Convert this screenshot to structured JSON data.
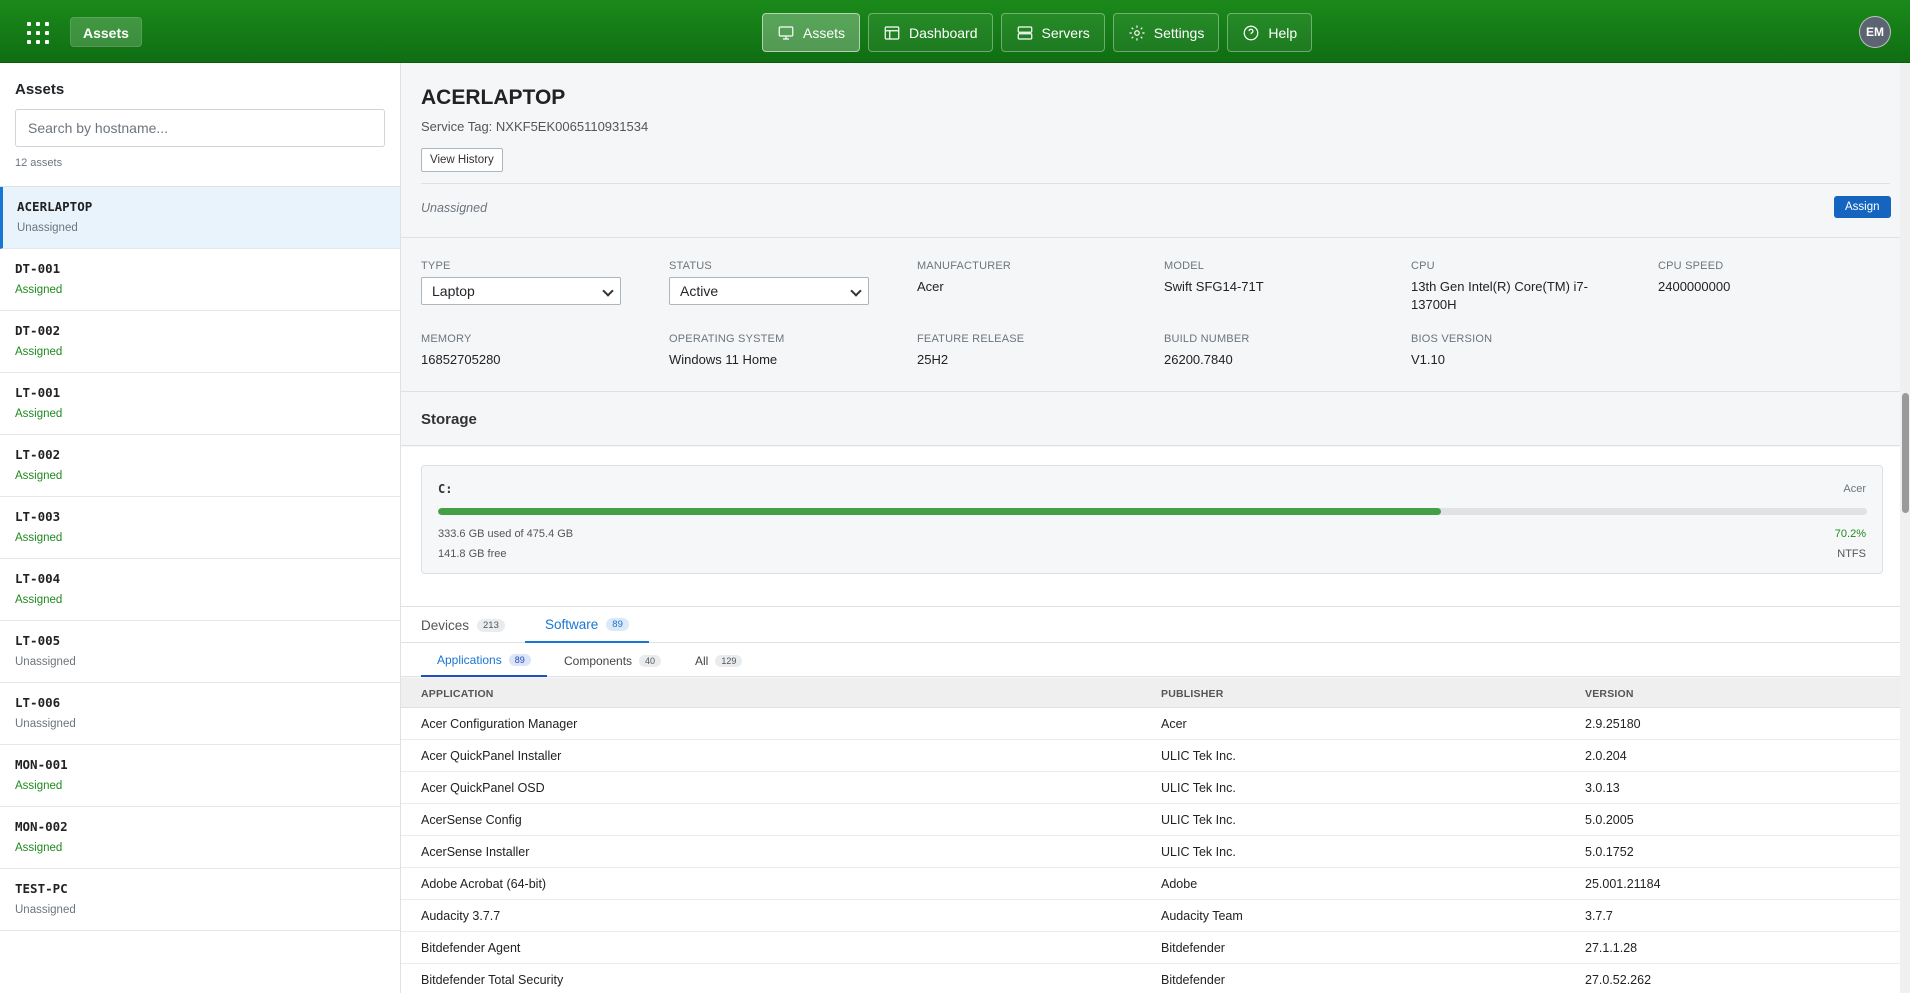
{
  "topbar": {
    "brand": "Assets",
    "nav": [
      {
        "label": "Assets",
        "icon": "monitor-icon",
        "active": true
      },
      {
        "label": "Dashboard",
        "icon": "dashboard-icon",
        "active": false
      },
      {
        "label": "Servers",
        "icon": "server-icon",
        "active": false
      },
      {
        "label": "Settings",
        "icon": "gear-icon",
        "active": false
      },
      {
        "label": "Help",
        "icon": "help-circle-icon",
        "active": false
      }
    ],
    "avatar_initials": "EM"
  },
  "sidebar": {
    "title": "Assets",
    "search_placeholder": "Search by hostname...",
    "count": "12 assets",
    "items": [
      {
        "host": "ACERLAPTOP",
        "status": "Unassigned",
        "selected": true
      },
      {
        "host": "DT-001",
        "status": "Assigned"
      },
      {
        "host": "DT-002",
        "status": "Assigned"
      },
      {
        "host": "LT-001",
        "status": "Assigned"
      },
      {
        "host": "LT-002",
        "status": "Assigned"
      },
      {
        "host": "LT-003",
        "status": "Assigned"
      },
      {
        "host": "LT-004",
        "status": "Assigned"
      },
      {
        "host": "LT-005",
        "status": "Unassigned"
      },
      {
        "host": "LT-006",
        "status": "Unassigned"
      },
      {
        "host": "MON-001",
        "status": "Assigned"
      },
      {
        "host": "MON-002",
        "status": "Assigned"
      },
      {
        "host": "TEST-PC",
        "status": "Unassigned"
      }
    ]
  },
  "asset": {
    "name": "ACERLAPTOP",
    "service_tag": "Service Tag: NXKF5EK0065110931534",
    "history_label": "View History",
    "assignment": "Unassigned",
    "assign_label": "Assign"
  },
  "details": {
    "type": {
      "label": "TYPE",
      "value": "Laptop"
    },
    "status": {
      "label": "STATUS",
      "value": "Active"
    },
    "manufacturer": {
      "label": "MANUFACTURER",
      "value": "Acer"
    },
    "model": {
      "label": "MODEL",
      "value": "Swift SFG14-71T"
    },
    "cpu": {
      "label": "CPU",
      "value": "13th Gen Intel(R) Core(TM) i7-13700H"
    },
    "cpu_speed": {
      "label": "CPU SPEED",
      "value": "2400000000"
    },
    "memory": {
      "label": "MEMORY",
      "value": "16852705280"
    },
    "os": {
      "label": "OPERATING SYSTEM",
      "value": "Windows 11 Home"
    },
    "feature_release": {
      "label": "FEATURE RELEASE",
      "value": "25H2"
    },
    "build": {
      "label": "BUILD NUMBER",
      "value": "26200.7840"
    },
    "bios": {
      "label": "BIOS VERSION",
      "value": "V1.10"
    }
  },
  "storage": {
    "title": "Storage",
    "disks": [
      {
        "name": "C:",
        "vendor": "Acer",
        "used": "333.6 GB used of 475.4 GB",
        "free": "141.8 GB free",
        "percent_label": "70.2%",
        "percent": 70.2,
        "filesystem": "NTFS"
      }
    ]
  },
  "tabs": [
    {
      "label": "Devices",
      "count": "213",
      "active": false
    },
    {
      "label": "Software",
      "count": "89",
      "active": true
    }
  ],
  "subtabs": [
    {
      "label": "Applications",
      "count": "89",
      "active": true
    },
    {
      "label": "Components",
      "count": "40",
      "active": false
    },
    {
      "label": "All",
      "count": "129",
      "active": false
    }
  ],
  "software": {
    "columns": [
      "APPLICATION",
      "PUBLISHER",
      "VERSION"
    ],
    "rows": [
      [
        "Acer Configuration Manager",
        "Acer",
        "2.9.25180"
      ],
      [
        "Acer QuickPanel Installer",
        "ULIC Tek Inc.",
        "2.0.204"
      ],
      [
        "Acer QuickPanel OSD",
        "ULIC Tek Inc.",
        "3.0.13"
      ],
      [
        "AcerSense Config",
        "ULIC Tek Inc.",
        "5.0.2005"
      ],
      [
        "AcerSense Installer",
        "ULIC Tek Inc.",
        "5.0.1752"
      ],
      [
        "Adobe Acrobat (64-bit)",
        "Adobe",
        "25.001.21184"
      ],
      [
        "Audacity 3.7.7",
        "Audacity Team",
        "3.7.7"
      ],
      [
        "Bitdefender Agent",
        "Bitdefender",
        "27.1.1.28"
      ],
      [
        "Bitdefender Total Security",
        "Bitdefender",
        "27.0.52.262"
      ]
    ]
  }
}
